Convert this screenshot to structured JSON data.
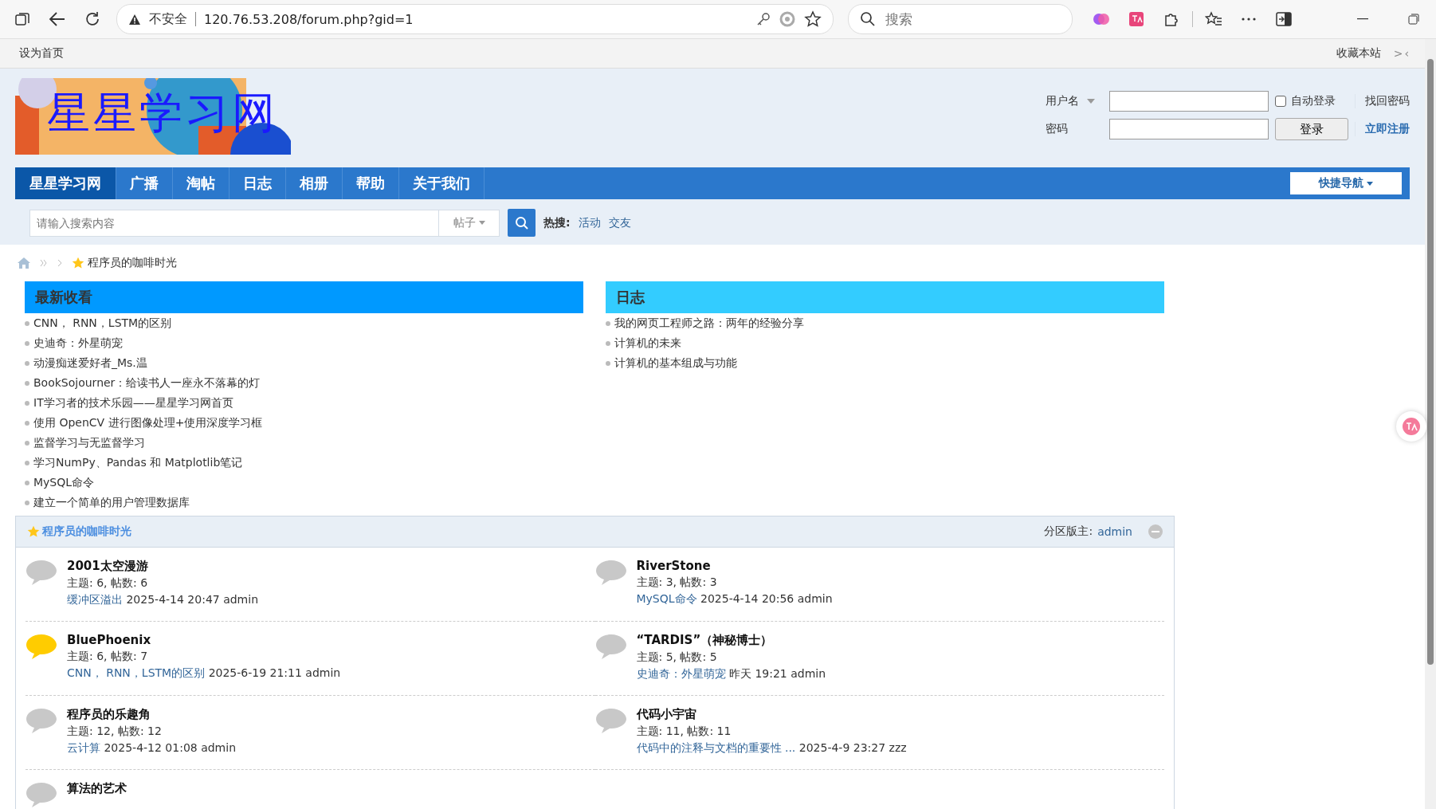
{
  "browser": {
    "security": "不安全",
    "url": "120.76.53.208/forum.php?gid=1",
    "search_placeholder": "搜索"
  },
  "topbar": {
    "left": "设为首页",
    "right": "收藏本站",
    "collapse": ">‹"
  },
  "logo": {
    "text": "星星学习网"
  },
  "login": {
    "username_label": "用户名",
    "password_label": "密码",
    "auto_login": {
      "label": "自动登录",
      "checked": false
    },
    "forgot": "找回密码",
    "login_button": "登录",
    "register": "立即注册"
  },
  "nav": {
    "items": [
      {
        "label": "星星学习网",
        "selected": true
      },
      {
        "label": "广播",
        "selected": false
      },
      {
        "label": "淘帖",
        "selected": false
      },
      {
        "label": "日志",
        "selected": false
      },
      {
        "label": "相册",
        "selected": false
      },
      {
        "label": "帮助",
        "selected": false
      },
      {
        "label": "关于我们",
        "selected": false
      }
    ],
    "quick_nav": "快捷导航"
  },
  "search": {
    "placeholder": "请输入搜索内容",
    "scope": "帖子",
    "hot_label": "热搜:",
    "hot": [
      "活动",
      "交友"
    ]
  },
  "breadcrumb": {
    "current": "程序员的咖啡时光"
  },
  "panels": [
    {
      "title": "最新收看",
      "color": "#0099ff",
      "items": [
        "CNN， RNN，LSTM的区别",
        "史迪奇：外星萌宠",
        "动漫痴迷爱好者_Ms.温",
        "BookSojourner：给读书人一座永不落幕的灯",
        "IT学习者的技术乐园——星星学习网首页",
        "使用 OpenCV 进行图像处理+使用深度学习框",
        "监督学习与无监督学习",
        "学习NumPy、Pandas 和 Matplotlib笔记",
        "MySQL命令",
        "建立一个简单的用户管理数据库"
      ]
    },
    {
      "title": "日志",
      "color": "#33ccff",
      "items": [
        "我的网页工程师之路：两年的经验分享",
        "计算机的未来",
        "计算机的基本组成与功能"
      ]
    }
  ],
  "forum_group": {
    "title": "程序员的咖啡时光",
    "moderator_label": "分区版主:",
    "moderator": "admin",
    "forums": [
      {
        "name": "2001太空漫游",
        "new": false,
        "stats": "主题: 6, 帖数: 6",
        "last_post": "缓冲区溢出",
        "last_info": "2025-4-14 20:47 admin"
      },
      {
        "name": "RiverStone",
        "new": false,
        "stats": "主题: 3, 帖数: 3",
        "last_post": "MySQL命令",
        "last_info": "2025-4-14 20:56 admin"
      },
      {
        "name": "BluePhoenix",
        "new": true,
        "stats": "主题: 6, 帖数: 7",
        "last_post": "CNN， RNN，LSTM的区别",
        "last_info": "2025-6-19 21:11 admin"
      },
      {
        "name": "“TARDIS”（神秘博士）",
        "new": false,
        "stats": "主题: 5, 帖数: 5",
        "last_post": "史迪奇：外星萌宠",
        "last_info": "昨天 19:21 admin"
      },
      {
        "name": "程序员的乐趣角",
        "new": false,
        "stats": "主题: 12, 帖数: 12",
        "last_post": "云计算",
        "last_info": "2025-4-12 01:08 admin"
      },
      {
        "name": "代码小宇宙",
        "new": false,
        "stats": "主题: 11, 帖数: 11",
        "last_post": "代码中的注释与文档的重要性 ...",
        "last_info": "2025-4-9 23:27 zzz"
      },
      {
        "name": "算法的艺术",
        "new": false
      }
    ]
  }
}
